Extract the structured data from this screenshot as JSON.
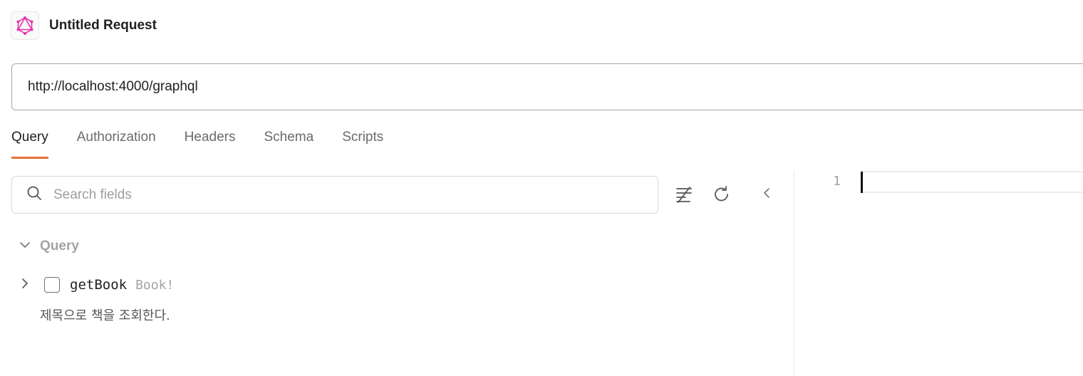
{
  "header": {
    "title": "Untitled Request",
    "icon": "graphql-icon",
    "icon_color": "#e535ab"
  },
  "url_bar": {
    "value": "http://localhost:4000/graphql"
  },
  "tabs": [
    {
      "label": "Query",
      "active": true
    },
    {
      "label": "Authorization",
      "active": false
    },
    {
      "label": "Headers",
      "active": false
    },
    {
      "label": "Schema",
      "active": false
    },
    {
      "label": "Scripts",
      "active": false
    }
  ],
  "explorer": {
    "search_placeholder": "Search fields",
    "section_label": "Query",
    "fields": [
      {
        "name": "getBook",
        "type": "Book!",
        "description": "제목으로 책을 조회한다."
      }
    ]
  },
  "editor": {
    "line_numbers": [
      "1"
    ]
  },
  "colors": {
    "accent": "#e8703a",
    "muted_text": "#a3a3a3"
  }
}
